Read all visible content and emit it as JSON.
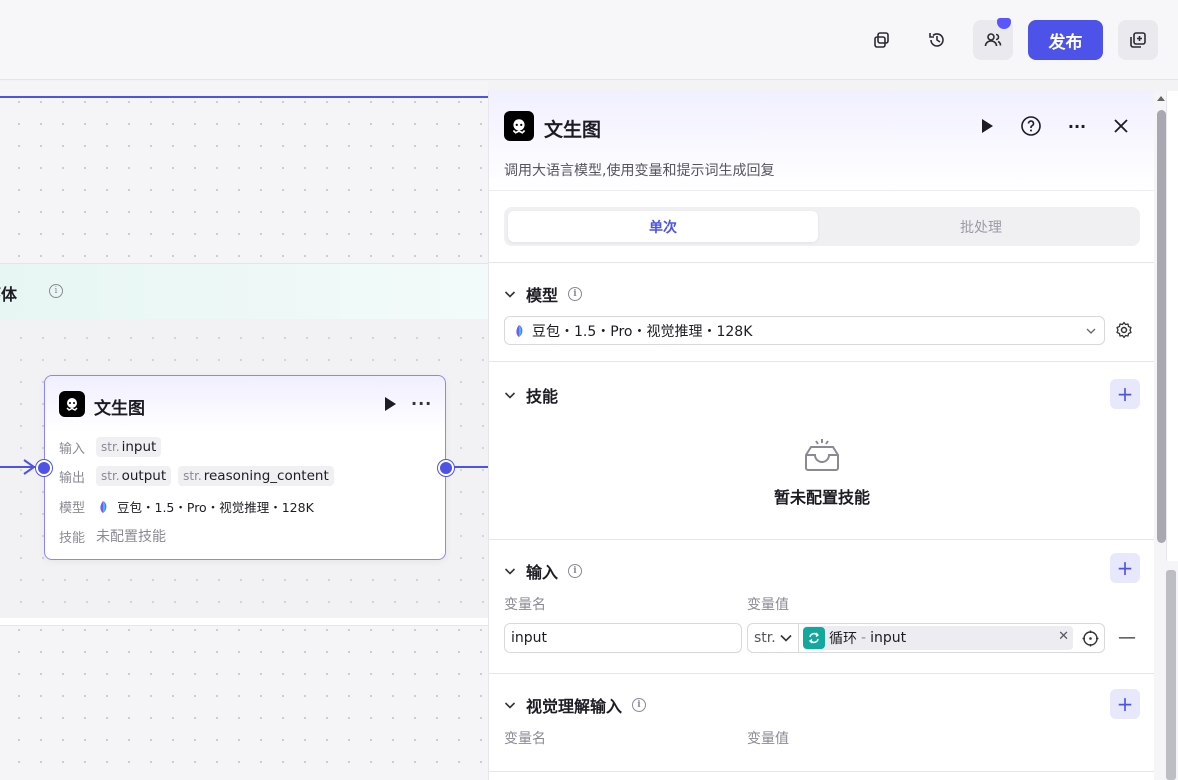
{
  "topbar": {
    "publish_label": "发布",
    "icons": [
      "copy-icon",
      "history-icon",
      "collaborators-icon",
      "add-panel-icon"
    ]
  },
  "canvas": {
    "loop_title": "循环体",
    "loop_title_visible": "循环体",
    "node": {
      "title": "文生图",
      "input_label": "输入",
      "input_type": "str.",
      "input_name": "input",
      "output_label": "输出",
      "outputs": [
        {
          "type": "str.",
          "name": "output"
        },
        {
          "type": "str.",
          "name": "reasoning_content"
        }
      ],
      "model_label": "模型",
      "model_value": "豆包・1.5・Pro・视觉推理・128K",
      "skill_label": "技能",
      "skill_value": "未配置技能"
    }
  },
  "panel": {
    "title": "文生图",
    "description": "调用大语言模型,使用变量和提示词生成回复",
    "tabs": [
      {
        "label": "单次",
        "active": true
      },
      {
        "label": "批处理",
        "active": false
      }
    ],
    "model_section": {
      "title": "模型",
      "selected": "豆包・1.5・Pro・视觉推理・128K"
    },
    "skill_section": {
      "title": "技能",
      "empty_text": "暂未配置技能"
    },
    "input_section": {
      "title": "输入",
      "col_name": "变量名",
      "col_value": "变量值",
      "row": {
        "name": "input",
        "type": "str.",
        "ref_source": "循环",
        "ref_sep": "-",
        "ref_var": "input"
      }
    },
    "vision_section": {
      "title": "视觉理解输入",
      "col_name": "变量名",
      "col_value": "变量值"
    }
  },
  "colors": {
    "accent": "#4d53e8",
    "loop_icon": "#12a89c"
  }
}
